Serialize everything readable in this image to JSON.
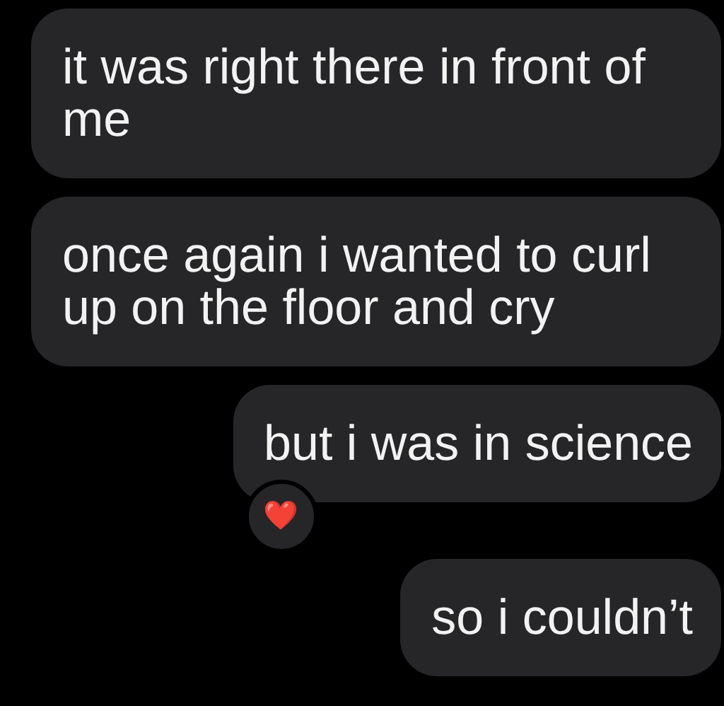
{
  "messages": [
    {
      "lines": [
        "it was right there in front of",
        "me"
      ],
      "kind": "wide"
    },
    {
      "lines": [
        "once again i wanted to curl",
        "up on the floor and cry"
      ],
      "kind": "wide"
    },
    {
      "lines": [
        "but i was in science"
      ],
      "kind": "short",
      "reaction": "❤️"
    },
    {
      "lines": [
        "so i couldn’t"
      ],
      "kind": "short"
    }
  ]
}
